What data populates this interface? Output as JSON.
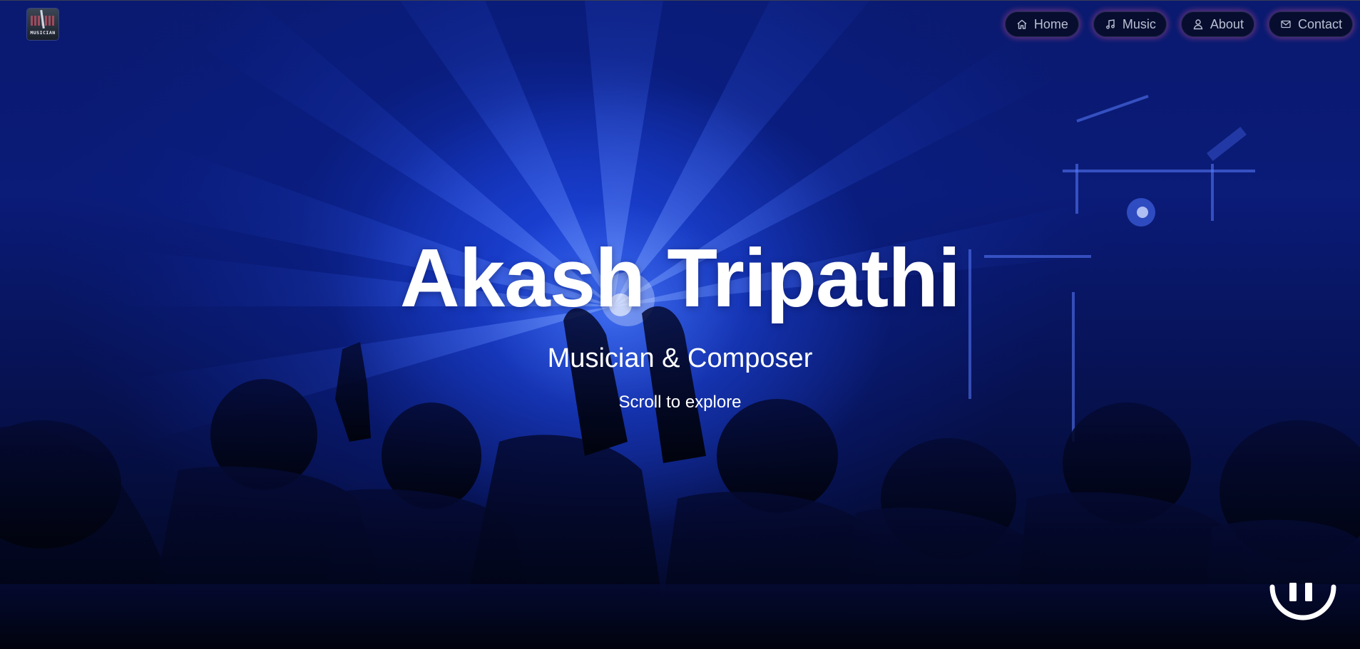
{
  "logo": {
    "text": "MUSICIAN",
    "icon": "guitar-logo-icon"
  },
  "nav": {
    "items": [
      {
        "label": "Home",
        "icon": "home-icon"
      },
      {
        "label": "Music",
        "icon": "music-note-icon"
      },
      {
        "label": "About",
        "icon": "user-icon"
      },
      {
        "label": "Contact",
        "icon": "mail-icon"
      }
    ]
  },
  "hero": {
    "title": "Akash Tripathi",
    "subtitle": "Musician & Composer",
    "scroll_hint": "Scroll to explore"
  },
  "video_control": {
    "icon": "pause-icon"
  },
  "colors": {
    "background_blue": "#0a1b78",
    "text": "#ffffff",
    "nav_bg": "#060c28",
    "nav_text": "#b9c0d2",
    "nav_glow": "#dc508c"
  }
}
